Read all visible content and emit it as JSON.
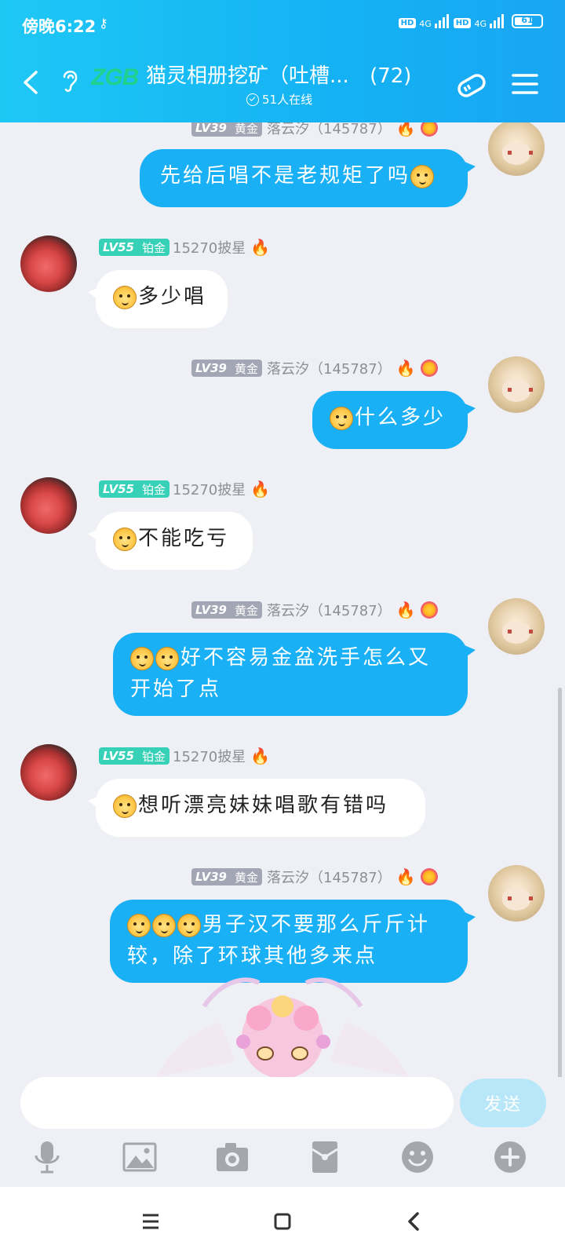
{
  "status_bar": {
    "time": "傍晚6:22",
    "network_left": "4G",
    "network_right": "4G",
    "hd_label": "HD",
    "battery": "61"
  },
  "header": {
    "logo_text": "ZGB",
    "title": "猫灵相册挖矿（吐槽...",
    "member_count": "(72)",
    "online_text": "51人在线"
  },
  "users": {
    "me": {
      "level": "LV39",
      "rank": "黄金",
      "name": "落云汐（145787）"
    },
    "other": {
      "level": "LV55",
      "rank": "铂金",
      "name": "15270披星"
    }
  },
  "messages": [
    {
      "from": "me",
      "text": "先给后唱不是老规矩了吗"
    },
    {
      "from": "other",
      "text": "多少唱"
    },
    {
      "from": "me",
      "text": "什么多少"
    },
    {
      "from": "other",
      "text": "不能吃亏"
    },
    {
      "from": "me",
      "line1": "好不容易金盆洗手怎么又",
      "line2": "开始了点"
    },
    {
      "from": "other",
      "text": "想听漂亮妹妹唱歌有错吗"
    },
    {
      "from": "me",
      "line1": "男子汉不要那么斤斤计",
      "line2": "较，除了环球其他多来点"
    }
  ],
  "input": {
    "placeholder": "",
    "send_label": "发送"
  },
  "icons": {
    "toolbar": [
      "microphone-icon",
      "image-icon",
      "camera-icon",
      "red-packet-icon",
      "emoji-icon",
      "plus-icon"
    ],
    "system_nav": [
      "menu-icon",
      "home-icon",
      "back-icon"
    ]
  },
  "colors": {
    "header_gradient_start": "#1ec8f5",
    "header_gradient_end": "#19a6f2",
    "my_bubble": "#1ab0f5",
    "other_bubble": "#ffffff",
    "background": "#eef0f5",
    "send_button": "#b9e7fa",
    "gold_badge": "#a3a6b4",
    "platinum_badge": "#37d1b8"
  }
}
